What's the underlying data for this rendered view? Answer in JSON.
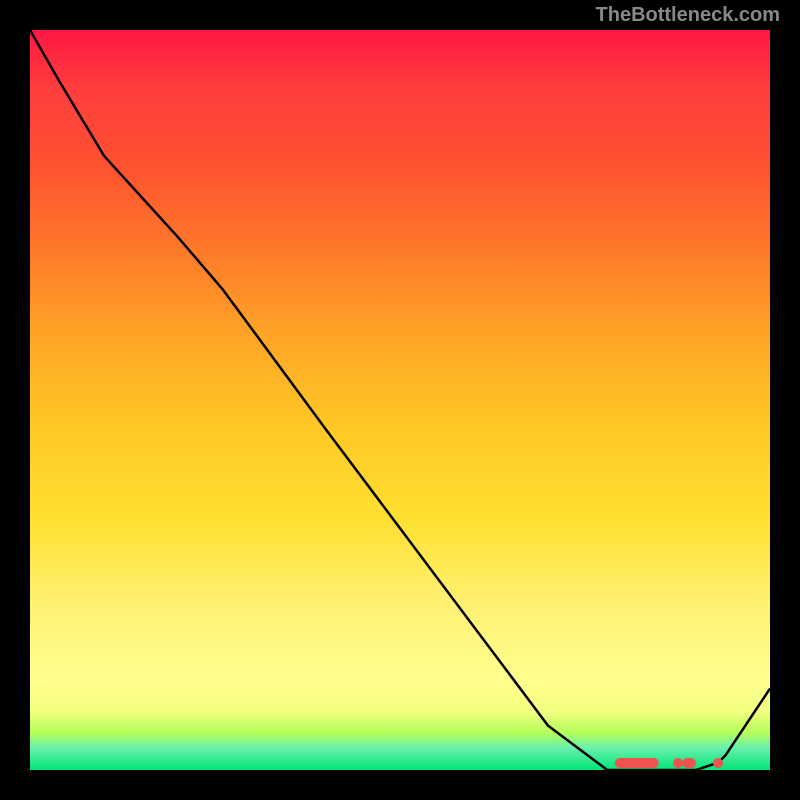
{
  "watermark": "TheBottleneck.com",
  "chart_data": {
    "type": "line",
    "title": "",
    "xlabel": "",
    "ylabel": "",
    "x": [
      0.0,
      0.04,
      0.1,
      0.2,
      0.26,
      0.4,
      0.55,
      0.7,
      0.78,
      0.8,
      0.82,
      0.84,
      0.87,
      0.9,
      0.93,
      0.94,
      1.0
    ],
    "values": [
      1.0,
      0.93,
      0.83,
      0.72,
      0.65,
      0.46,
      0.26,
      0.06,
      0.0,
      0.0,
      0.0,
      0.0,
      0.0,
      0.0,
      0.01,
      0.02,
      0.11
    ],
    "xlim": [
      0,
      1
    ],
    "ylim": [
      0,
      1
    ],
    "grid": false,
    "background_gradient": [
      "#ff1744",
      "#ffa726",
      "#fff176",
      "#00e676"
    ],
    "markers": {
      "type": "pill-dot-cluster",
      "x_range": [
        0.79,
        0.93
      ],
      "y": 0.01,
      "color": "#ef5350"
    },
    "annotations": [
      "TheBottleneck.com"
    ]
  }
}
